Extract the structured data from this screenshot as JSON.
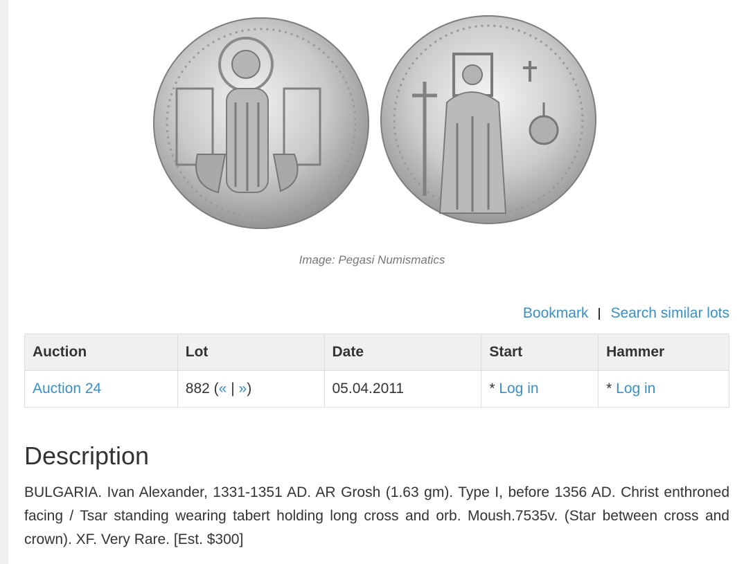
{
  "image": {
    "alt": "Coin obverse and reverse",
    "caption": "Image: Pegasi Numismatics"
  },
  "actions": {
    "bookmark_label": "Bookmark",
    "search_similar_label": "Search similar lots"
  },
  "lot_table": {
    "headers": [
      "Auction",
      "Lot",
      "Date",
      "Start",
      "Hammer"
    ],
    "row": {
      "auction": "Auction 24",
      "lot_number": "882",
      "lot_prev": "«",
      "lot_sep": "|",
      "lot_next": "»",
      "date": "05.04.2011",
      "start_prefix": "* ",
      "start_link": "Log in",
      "hammer_prefix": "* ",
      "hammer_link": "Log in"
    }
  },
  "description": {
    "heading": "Description",
    "text": "BULGARIA. Ivan Alexander, 1331-1351 AD. AR Grosh (1.63 gm). Type I, before 1356 AD. Christ enthroned facing / Tsar standing wearing tabert holding long cross and orb. Moush.7535v. (Star between cross and crown). XF. Very Rare. [Est. $300]"
  },
  "colors": {
    "link": "#3a8fc4",
    "text": "#333333",
    "header_bg": "#f0f0f0",
    "border": "#dddddd",
    "caption": "#777777"
  }
}
